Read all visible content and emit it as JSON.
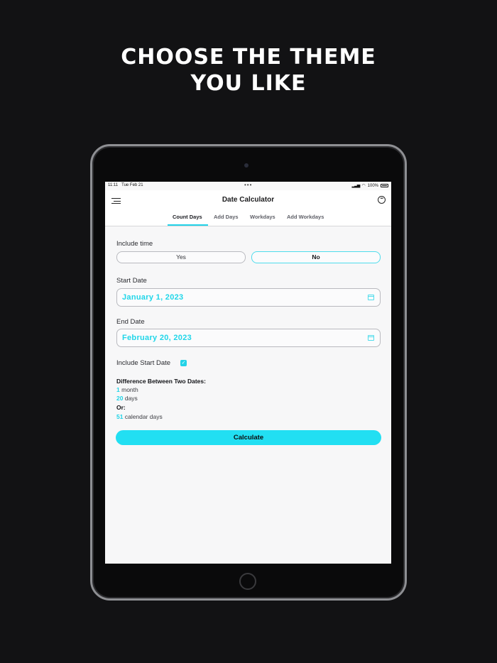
{
  "promo": {
    "line1": "CHOOSE THE THEME",
    "line2": "YOU LIKE"
  },
  "statusbar": {
    "time": "11:11",
    "date": "Tue Feb 21",
    "dots": "•••",
    "battery": "100%"
  },
  "navbar": {
    "title": "Date Calculator",
    "tabs": [
      "Count Days",
      "Add Days",
      "Workdays",
      "Add Workdays"
    ],
    "active_tab": "Count Days",
    "accent": "#22d3e8"
  },
  "form": {
    "include_time_label": "Include time",
    "include_time_options": [
      "Yes",
      "No"
    ],
    "include_time_selected": "No",
    "start_date_label": "Start Date",
    "start_date_value": "January 1, 2023",
    "end_date_label": "End Date",
    "end_date_value": "February 20, 2023",
    "include_start_label": "Include Start Date",
    "include_start_checked": true
  },
  "result": {
    "heading": "Difference Between Two Dates:",
    "months_num": "1",
    "months_unit": "month",
    "days_num": "20",
    "days_unit": "days",
    "or_label": "Or:",
    "calendar_num": "51",
    "calendar_unit": "calendar days"
  },
  "calculate_label": "Calculate"
}
